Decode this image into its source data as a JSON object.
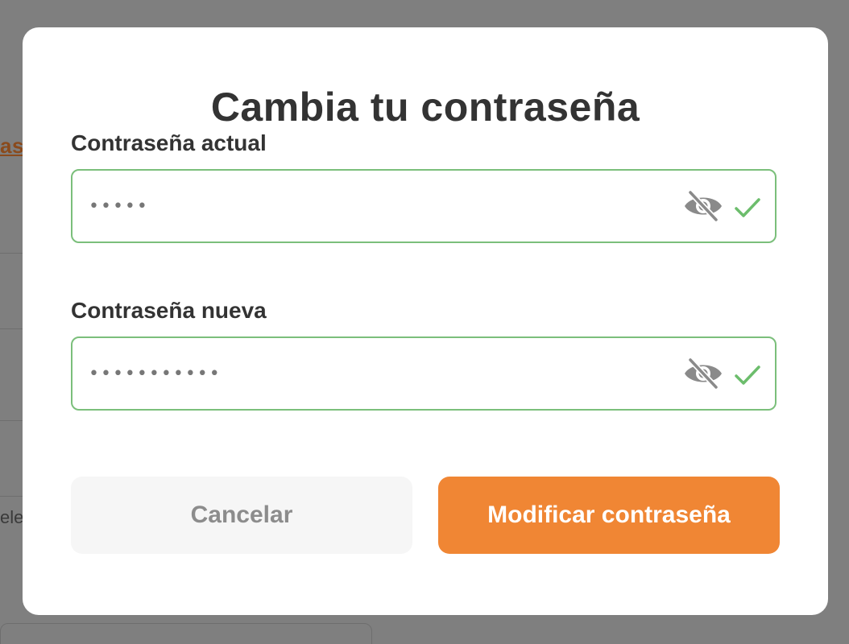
{
  "background": {
    "link_fragment": "as",
    "text_fragment": "elec"
  },
  "modal": {
    "title": "Cambia tu contraseña",
    "current_password": {
      "label": "Contraseña actual",
      "value": "•••••"
    },
    "new_password": {
      "label": "Contraseña nueva",
      "value": "•••••••••••"
    },
    "cancel_label": "Cancelar",
    "submit_label": "Modificar contraseña"
  },
  "colors": {
    "accent": "#f08634",
    "valid": "#7bbf7b",
    "text": "#333333",
    "overlay": "#7f7f7f"
  },
  "icons": {
    "visibility_toggle": "eye-off-icon",
    "valid": "check-icon"
  }
}
